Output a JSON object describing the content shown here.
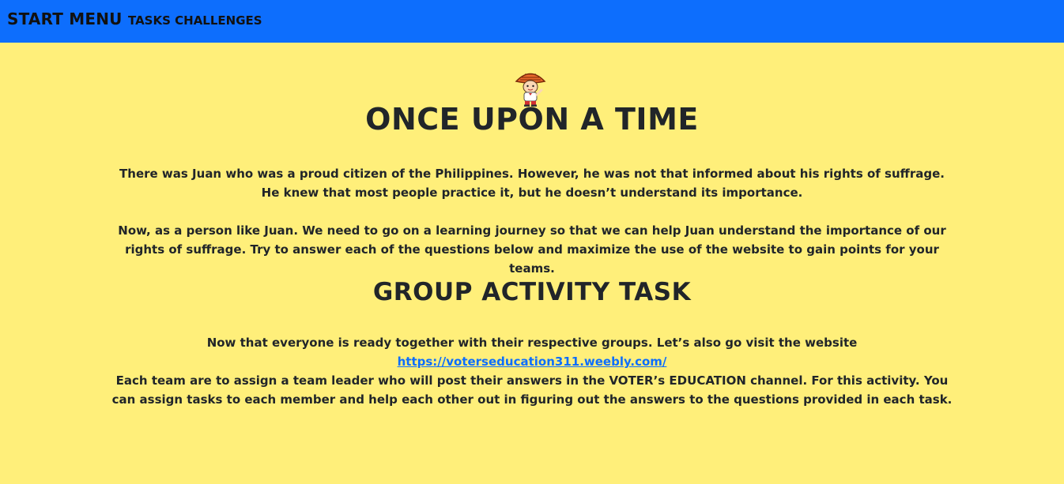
{
  "nav": {
    "brand": "START MENU",
    "link": "TASKS CHALLENGES"
  },
  "colors": {
    "navbar": "#0D6EFD",
    "background": "#FFEF7A",
    "link": "#0D6EFD",
    "text": "#212529"
  },
  "mascot": {
    "icon": "juan-mascot-icon"
  },
  "story": {
    "title": "ONCE UPON A TIME",
    "paragraph_1": "There was Juan who was a proud citizen of the Philippines. However, he was not that informed about his rights of suffrage. He knew that most people practice it, but he doesn’t understand its importance.",
    "paragraph_2": "Now, as a person like Juan. We need to go on a learning journey so that we can help Juan understand the importance of our rights of suffrage. Try to answer each of the questions below and maximize the use of the website to gain points for your teams."
  },
  "task": {
    "title": "GROUP ACTIVITY TASK",
    "intro": "Now that everyone is ready together with their respective groups. Let’s also go visit the website ",
    "link_text": "https://voterseducation311.weebly.com/",
    "rest": "Each team are to assign a team leader who will post their answers in the VOTER’s EDUCATION channel. For this activity. You can assign tasks to each member and help each other out in figuring out the answers to the questions provided in each task."
  }
}
